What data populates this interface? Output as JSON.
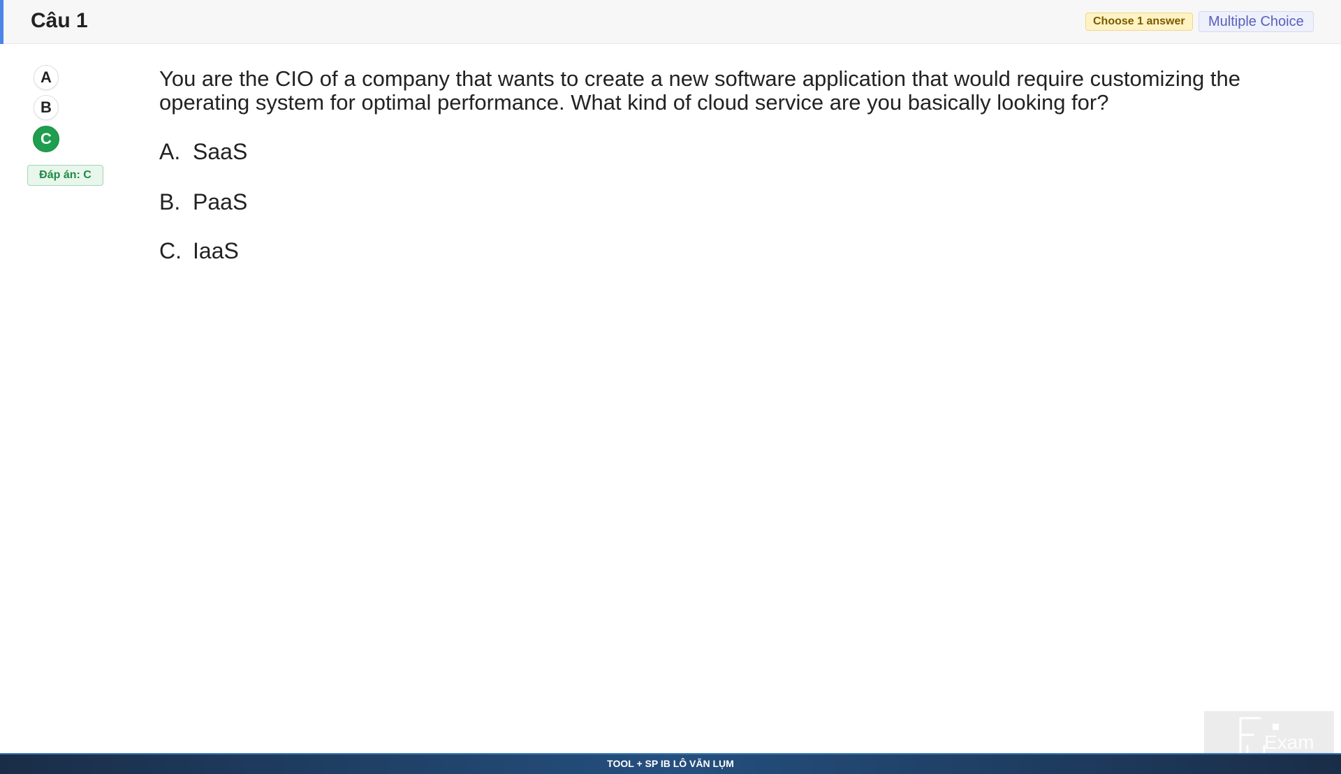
{
  "header": {
    "title": "Câu 1",
    "choose_badge": "Choose 1 answer",
    "type_badge": "Multiple Choice",
    "accent_color": "#4a86e8"
  },
  "selector": {
    "options": [
      {
        "letter": "A",
        "selected": false
      },
      {
        "letter": "B",
        "selected": false
      },
      {
        "letter": "C",
        "selected": true
      }
    ],
    "selected_color": "#1e9e4e",
    "answer_label": "Đáp án: C"
  },
  "question": {
    "text": "You are the CIO of a company that wants to create a new software application that would require customizing the operating system for optimal performance. What kind of cloud service are you basically looking for?",
    "choices": [
      {
        "letter": "A.",
        "text": "SaaS"
      },
      {
        "letter": "B.",
        "text": "PaaS"
      },
      {
        "letter": "C.",
        "text": "IaaS"
      }
    ]
  },
  "footer": {
    "text": "TOOL + SP IB LÔ VĂN LỤM"
  },
  "logo": {
    "text": "Exam",
    "icon": "fu-exam-logo-icon"
  }
}
